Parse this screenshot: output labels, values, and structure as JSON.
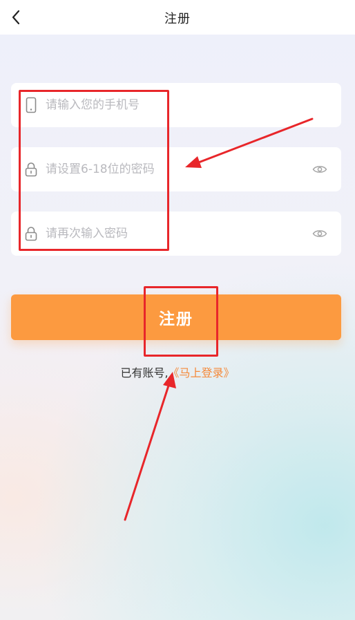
{
  "header": {
    "title": "注册",
    "back_icon": "chevron-left-icon"
  },
  "form": {
    "phone": {
      "placeholder": "请输入您的手机号",
      "icon": "phone-icon"
    },
    "password": {
      "placeholder": "请设置6-18位的密码",
      "icon": "lock-icon",
      "toggle_icon": "eye-icon"
    },
    "confirm": {
      "placeholder": "请再次输入密码",
      "icon": "lock-icon",
      "toggle_icon": "eye-icon"
    },
    "submit_label": "注册"
  },
  "footer": {
    "prompt": "已有账号,",
    "link": "《马上登录》"
  },
  "colors": {
    "accent": "#fc9a40",
    "link": "#f5893a",
    "annotation": "#e8262a"
  }
}
